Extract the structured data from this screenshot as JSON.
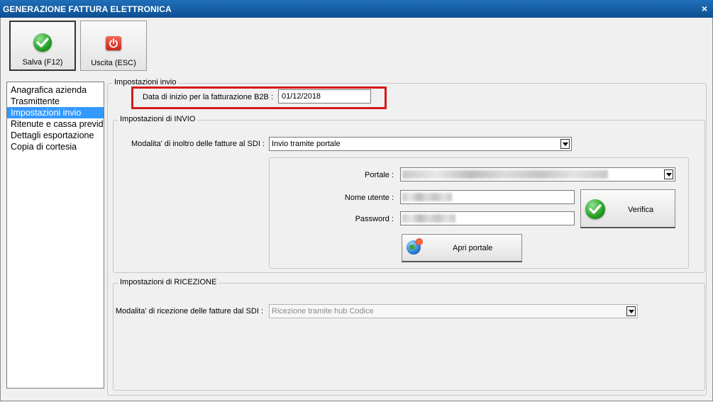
{
  "window": {
    "title": "GENERAZIONE FATTURA ELETTRONICA",
    "close_glyph": "×"
  },
  "toolbar": {
    "save_label": "Salva (F12)",
    "save_icon": "green-check-icon",
    "exit_label": "Uscita (ESC)",
    "exit_icon": "red-power-icon"
  },
  "sidebar": {
    "items": [
      {
        "label": "Anagrafica azienda",
        "selected": false
      },
      {
        "label": "Trasmittente",
        "selected": false
      },
      {
        "label": "Impostazioni invio",
        "selected": true
      },
      {
        "label": "Ritenute e cassa previdenziale",
        "selected": false
      },
      {
        "label": "Dettagli esportazione",
        "selected": false
      },
      {
        "label": "Copia di cortesia",
        "selected": false
      }
    ]
  },
  "main": {
    "group_title": "Impostazioni invio",
    "start_date_label": "Data di inizio per la fatturazione B2B :",
    "start_date_value": "01/12/2018",
    "invio": {
      "group_title": "Impostazioni di INVIO",
      "mode_label": "Modalita' di inoltro delle fatture al SDI :",
      "mode_value": "Invio tramite portale",
      "portal_label": "Portale :",
      "user_label": "Nome utente :",
      "password_label": "Password :",
      "verify_label": "Verifica",
      "open_portal_label": "Apri portale"
    },
    "ricezione": {
      "group_title": "Impostazioni di RICEZIONE",
      "mode_label": "Modalita' di ricezione delle fatture dal SDI :",
      "mode_value": "Ricezione tramite hub Codice"
    }
  },
  "colors": {
    "title_bar": "#0d4f93",
    "selection": "#3399ff",
    "highlight_box": "#d51a1a"
  }
}
